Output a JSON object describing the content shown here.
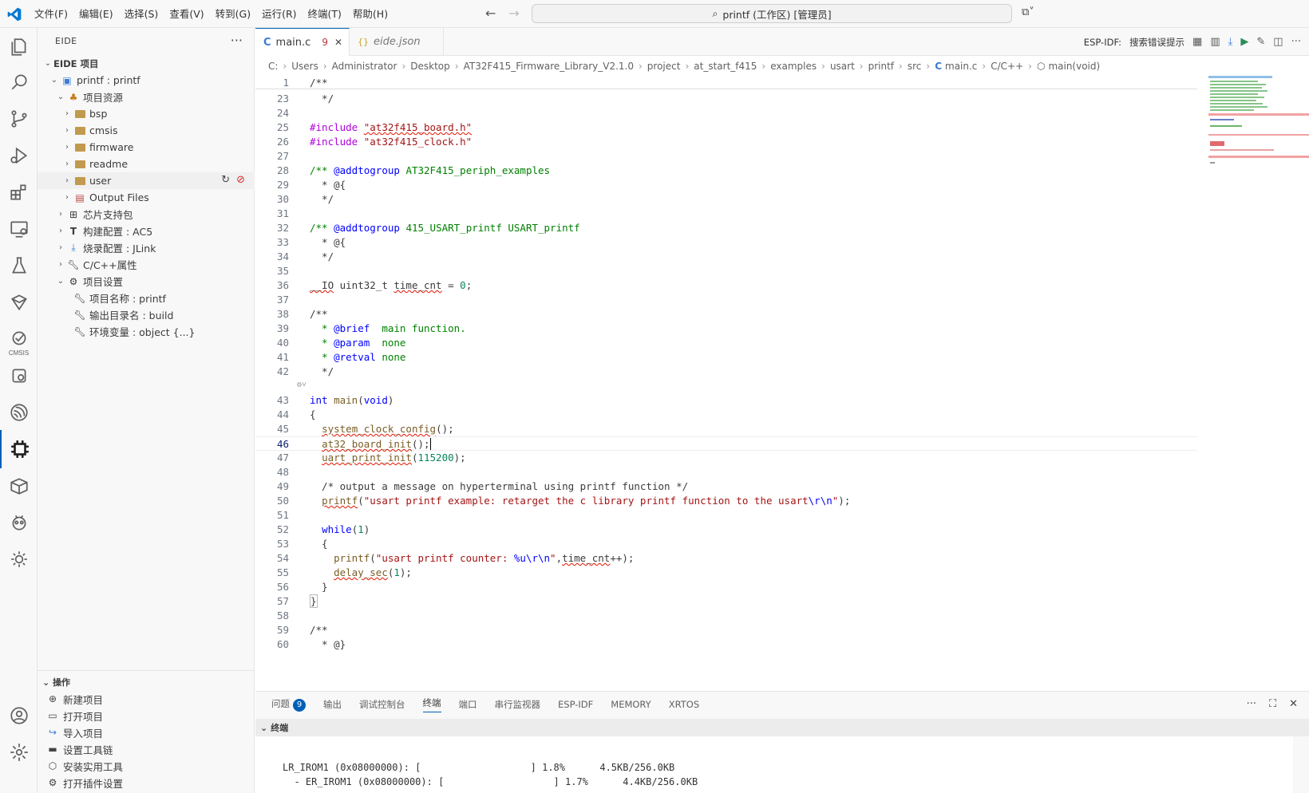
{
  "titlebar": {
    "menus": [
      "文件(F)",
      "编辑(E)",
      "选择(S)",
      "查看(V)",
      "转到(G)",
      "运行(R)",
      "终端(T)",
      "帮助(H)"
    ],
    "search_text": "printf (工作区) [管理员]"
  },
  "activity_bar": {
    "icons": [
      "explorer-icon",
      "search-icon",
      "source-control-icon",
      "run-debug-icon",
      "extensions-icon",
      "remote-explorer-icon",
      "testing-icon",
      "arduino-icon",
      "cmsis-icon",
      "chip-settings-icon",
      "espressif-icon",
      "eide-chip-icon",
      "package-icon",
      "platformio-icon",
      "gear-chip-icon",
      "account-icon",
      "manage-icon"
    ],
    "cmsis_label": "CMSIS"
  },
  "sidebar": {
    "title": "EIDE",
    "section_title": "EIDE 项目",
    "project": "printf : printf",
    "project_resources": "项目资源",
    "folders": [
      "bsp",
      "cmsis",
      "firmware",
      "readme",
      "user",
      "Output Files"
    ],
    "chip_pack": "芯片支持包",
    "build_config": "构建配置 : AC5",
    "flash_config": "烧录配置 : JLink",
    "cpp_props": "C/C++属性",
    "project_settings": "项目设置",
    "settings_items": [
      "项目名称 : printf",
      "输出目录名 : build",
      "环境变量 : object {...}"
    ],
    "ops_title": "操作",
    "ops": [
      "新建项目",
      "打开项目",
      "导入项目",
      "设置工具链",
      "安装实用工具",
      "打开插件设置"
    ]
  },
  "tabs": [
    {
      "label": "main.c",
      "problems": "9",
      "icon": "C"
    },
    {
      "label": "eide.json",
      "icon": "{}"
    }
  ],
  "editor_actions": {
    "esp_label": "ESP-IDF:",
    "hint_label": "搜索错误提示"
  },
  "breadcrumb": [
    "C:",
    "Users",
    "Administrator",
    "Desktop",
    "AT32F415_Firmware_Library_V2.1.0",
    "project",
    "at_start_f415",
    "examples",
    "usart",
    "printf",
    "src",
    "main.c",
    "C/C++",
    "main(void)"
  ],
  "panel": {
    "tabs": [
      "问题",
      "输出",
      "调试控制台",
      "终端",
      "端口",
      "串行监视器",
      "ESP-IDF",
      "MEMORY",
      "XRTOS"
    ],
    "problems_count": "9",
    "terminal_header": "终端",
    "terminal_lines": [
      "LR_IROM1 (0x08000000): [                   ] 1.8%      4.5KB/256.0KB",
      "  - ER_IROM1 (0x08000000): [                   ] 1.7%      4.4KB/256.0KB"
    ]
  },
  "colors": {
    "accent": "#005fb8",
    "error_squiggle": "#e51400",
    "comment": "#008000",
    "keyword": "#0000ff",
    "string": "#a31515"
  }
}
